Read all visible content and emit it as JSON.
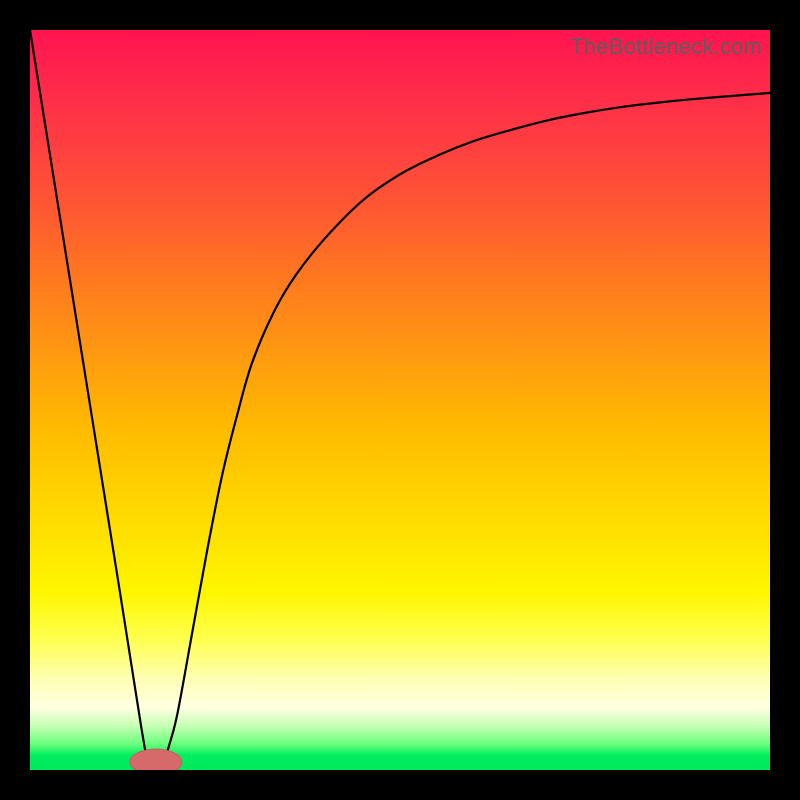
{
  "watermark": "TheBottleneck.com",
  "colors": {
    "frame": "#000000",
    "curve": "#000000",
    "marker_fill": "#d66a6a",
    "marker_stroke": "#c95a5a"
  },
  "chart_data": {
    "type": "line",
    "title": "",
    "xlabel": "",
    "ylabel": "",
    "xlim": [
      0,
      100
    ],
    "ylim": [
      0,
      100
    ],
    "grid": false,
    "legend": false,
    "note": "Y-axis is inverted visually: y=0 sits at the bottom green band; y=100 at the top red. Background encodes Y value (green=low, red=high).",
    "series": [
      {
        "name": "curve",
        "x": [
          0,
          4,
          8,
          12,
          15,
          16,
          17,
          18,
          19,
          20,
          22,
          24,
          26,
          28,
          30,
          33,
          36,
          40,
          45,
          50,
          55,
          60,
          65,
          70,
          75,
          80,
          85,
          90,
          95,
          100
        ],
        "y": [
          100,
          75,
          50,
          25,
          6,
          1,
          0,
          1,
          4,
          8,
          19,
          30,
          40,
          48,
          55,
          62,
          67,
          72,
          77,
          80.5,
          83,
          85,
          86.5,
          87.8,
          88.8,
          89.6,
          90.2,
          90.7,
          91.1,
          91.5
        ]
      }
    ],
    "marker": {
      "x": 17,
      "rx": 3.5,
      "ry": 1.2,
      "y": 0
    }
  }
}
